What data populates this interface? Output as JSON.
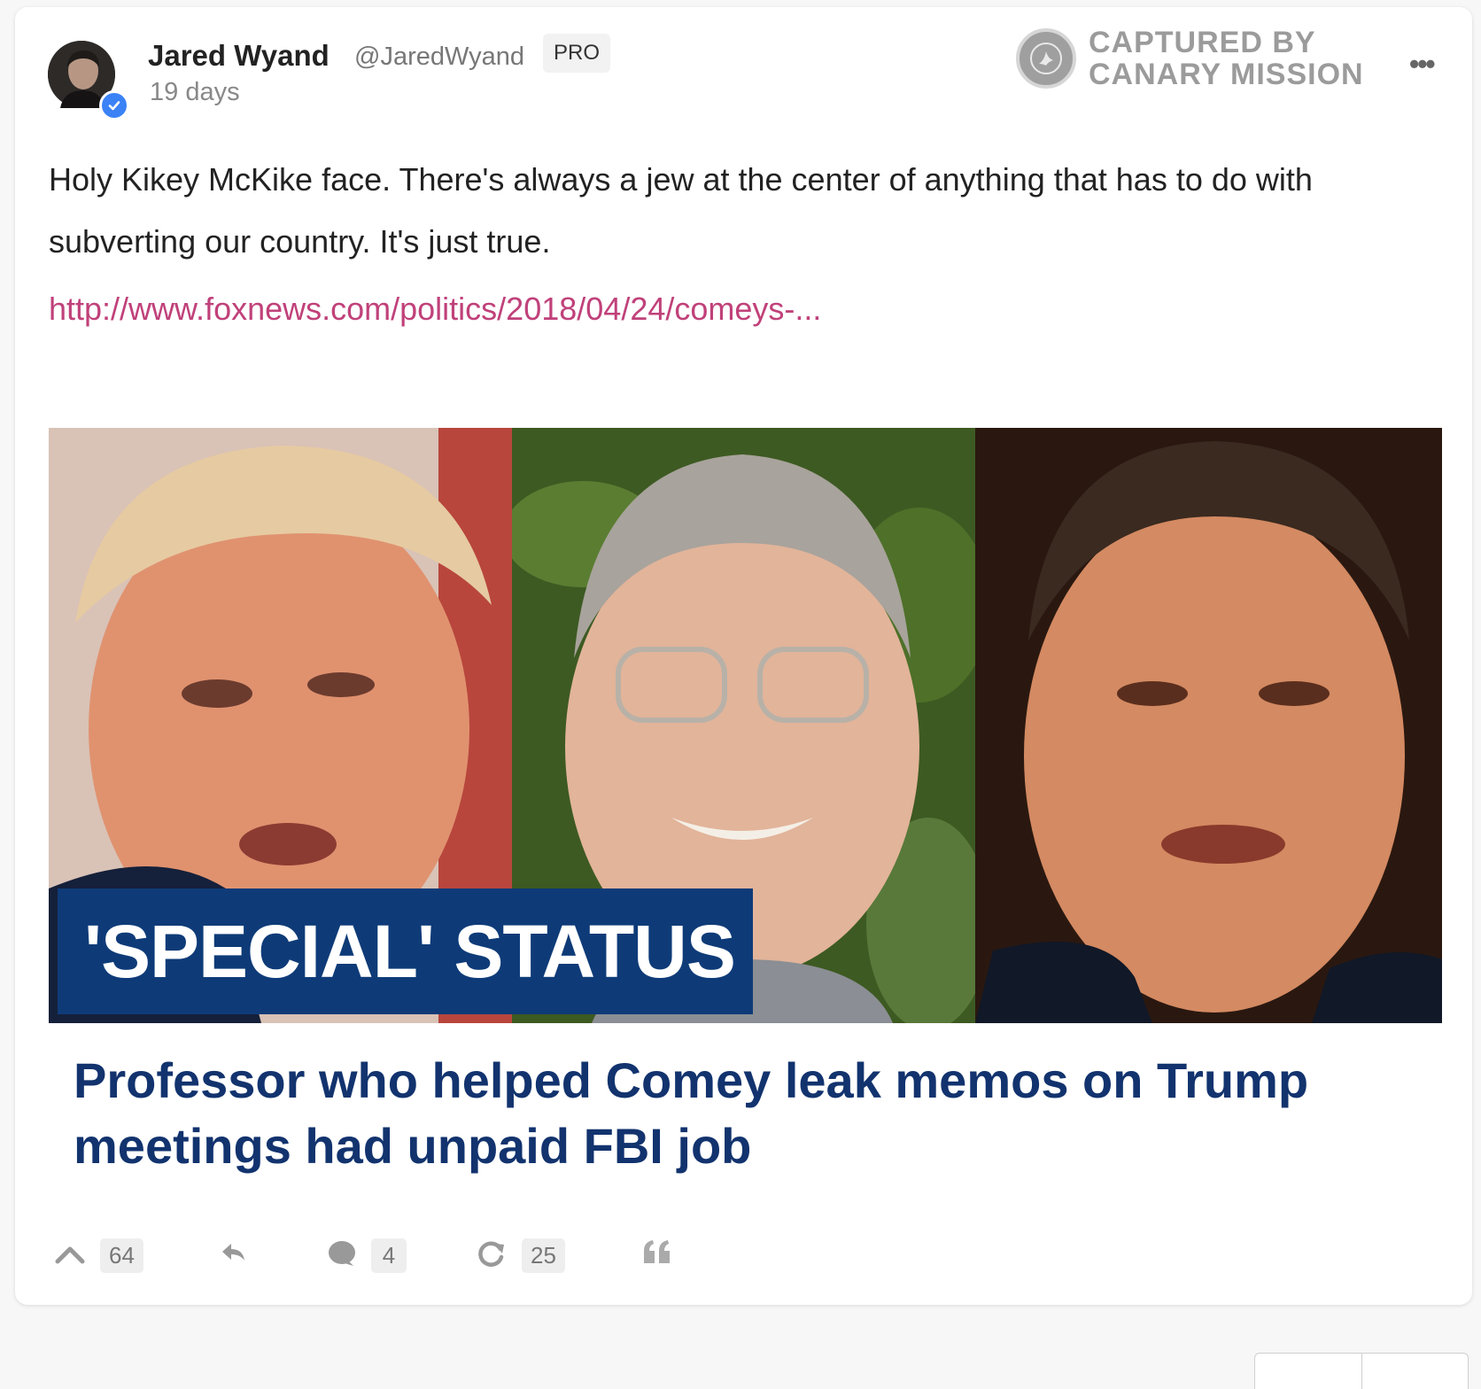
{
  "post": {
    "author": {
      "name": "Jared Wyand",
      "handle": "@JaredWyand",
      "badge": "PRO",
      "verified": true
    },
    "time": "19 days",
    "watermark": {
      "line1": "CAPTURED BY",
      "line2": "CANARY MISSION"
    },
    "body": "Holy Kikey McKike face. There's always a jew at the center of anything that has to do with subverting our country. It's just true.",
    "link_text": "http://www.foxnews.com/politics/2018/04/24/comeys-...",
    "preview": {
      "image_headline": "'SPECIAL' STATUS",
      "title": "Professor who helped Comey leak memos on Trump meetings had unpaid FBI job"
    },
    "actions": {
      "upvotes": "64",
      "comments": "4",
      "reposts": "25"
    }
  },
  "colors": {
    "link": "#c0417a",
    "headline_box": "#0e3b78",
    "preview_title": "#12336e",
    "verified": "#3b82f6"
  },
  "icons": [
    "verified-check-icon",
    "canary-seal-icon",
    "more-dots-icon",
    "upvote-chevron-icon",
    "reply-arrow-icon",
    "comment-bubble-icon",
    "repost-icon",
    "quote-icon"
  ]
}
